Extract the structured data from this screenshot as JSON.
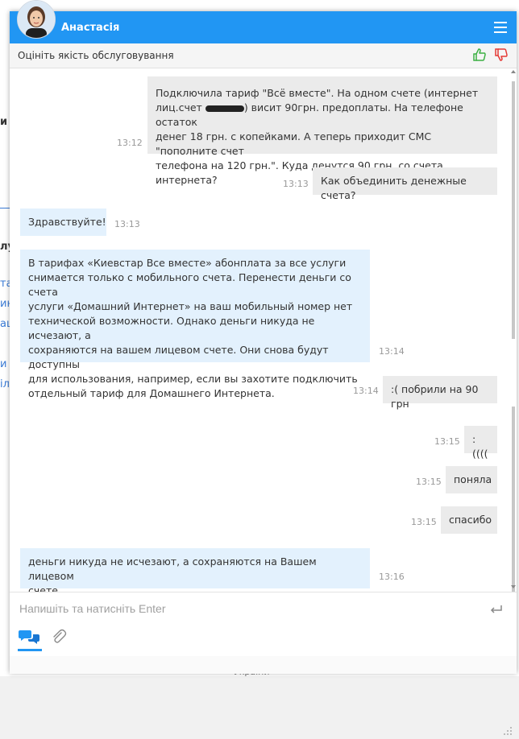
{
  "background": {
    "fragments": [
      "и",
      "лу",
      "та",
      "ин",
      "аш",
      "и",
      "іл"
    ],
    "bottom_text": "України"
  },
  "header": {
    "agent_name": "Анастасія",
    "menu_icon": "hamburger-icon",
    "color": "#2196f3"
  },
  "rating": {
    "label": "Оцініть якість обслуговування",
    "like_icon": "thumbs-up-icon",
    "dislike_icon": "thumbs-down-icon"
  },
  "messages": [
    {
      "dir": "out",
      "time": "13:12",
      "lines": [
        "Подключила тариф \"Всё вместе\". На одном счете (интернет",
        "лиц.счет",
        ") висит 90грн. предоплаты. На телефоне остаток",
        "денег 18 грн. с копейками. А теперь приходит СМС \"пополните счет",
        "телефона на 120 грн.\". Куда денутся 90 грн. со счета интернета?"
      ]
    },
    {
      "dir": "out",
      "time": "13:13",
      "lines": [
        "Как объединить денежные счета?"
      ]
    },
    {
      "dir": "in",
      "time": "13:13",
      "lines": [
        "Здравствуйте!"
      ]
    },
    {
      "dir": "in",
      "time": "13:14",
      "lines": [
        "В тарифах «Киевстар Все вместе» абонплата за все услуги",
        "снимается только с мобильного счета. Перенести деньги со счета",
        "услуги «Домашний Интернет» на ваш мобильный номер нет",
        "технической возможности. Однако деньги никуда не исчезают, а",
        "сохраняются на вашем лицевом счете. Они снова будут доступны",
        "для использования, например, если вы захотите подключить",
        "отдельный тариф для Домашнего Интернета."
      ]
    },
    {
      "dir": "out",
      "time": "13:14",
      "lines": [
        ":( побрили на 90 грн"
      ]
    },
    {
      "dir": "out",
      "time": "13:15",
      "lines": [
        ":(((("
      ]
    },
    {
      "dir": "out",
      "time": "13:15",
      "lines": [
        "поняла"
      ]
    },
    {
      "dir": "out",
      "time": "13:15",
      "lines": [
        "спасибо"
      ]
    },
    {
      "dir": "in",
      "time": "13:16",
      "lines": [
        "деньги никуда не исчезают, а сохраняются на Вашем лицевом",
        "счете"
      ]
    }
  ],
  "composer": {
    "placeholder": "Напишіть та натисніть Enter",
    "enter_icon": "enter-key-icon",
    "chat_icon": "chat-bubbles-icon",
    "attach_icon": "paperclip-icon",
    "resize_icon": "resize-grip-icon"
  }
}
